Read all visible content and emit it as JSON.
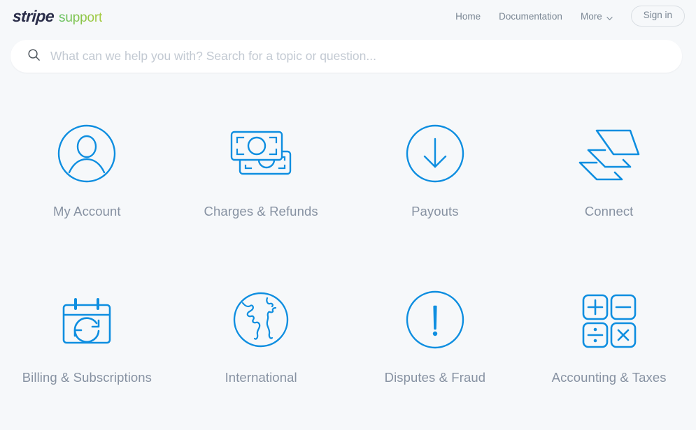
{
  "brand": {
    "name": "stripe",
    "product": "support",
    "logo_color": "#2b2e4a",
    "product_color": "#7dc242"
  },
  "nav": {
    "links": [
      {
        "label": "Home",
        "name": "nav-home"
      },
      {
        "label": "Documentation",
        "name": "nav-documentation"
      },
      {
        "label": "More",
        "name": "nav-more"
      }
    ],
    "more_icon": "chevron-down-icon",
    "signin_label": "Sign in"
  },
  "search": {
    "placeholder": "What can we help you with? Search for a topic or question...",
    "value": "",
    "icon": "search-icon"
  },
  "theme": {
    "background": "#f6f8fa",
    "icon_blue": "#0e8ee0",
    "label_gray": "#8792a2"
  },
  "categories": [
    {
      "label": "My Account",
      "icon": "user-circle-icon"
    },
    {
      "label": "Charges & Refunds",
      "icon": "banknotes-icon"
    },
    {
      "label": "Payouts",
      "icon": "arrow-down-circle-icon"
    },
    {
      "label": "Connect",
      "icon": "stacked-layers-icon"
    },
    {
      "label": "Billing & Subscriptions",
      "icon": "calendar-refresh-icon"
    },
    {
      "label": "International",
      "icon": "globe-icon"
    },
    {
      "label": "Disputes & Fraud",
      "icon": "exclamation-circle-icon"
    },
    {
      "label": "Accounting & Taxes",
      "icon": "calculator-operators-icon"
    }
  ]
}
